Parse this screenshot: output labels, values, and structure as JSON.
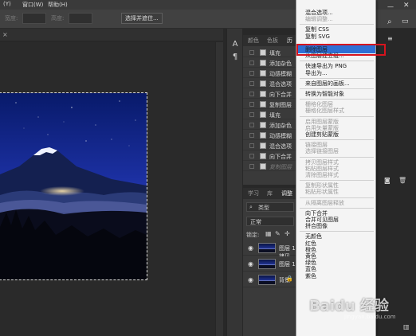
{
  "menubar": {
    "items": [
      "(Y)",
      "窗口(W)",
      "帮助(H)"
    ],
    "icons": [
      "home-icon",
      "minimize-icon",
      "close-icon"
    ]
  },
  "options_bar": {
    "width_label": "宽度:",
    "height_label": "高度:",
    "select_subject_button": "选择并遮住..."
  },
  "tool_column": {
    "text_tool_glyph": "A",
    "paragraph_glyph": "¶"
  },
  "history_panel": {
    "tabs": [
      "颜色",
      "色板",
      "历"
    ],
    "rows": [
      {
        "label": "填充",
        "dim": false
      },
      {
        "label": "添加杂色",
        "dim": false
      },
      {
        "label": "动感模糊",
        "dim": false
      },
      {
        "label": "混合选项",
        "dim": false
      },
      {
        "label": "向下合并",
        "dim": false
      },
      {
        "label": "复制图层",
        "dim": false
      },
      {
        "label": "填充",
        "dim": false
      },
      {
        "label": "添加杂色",
        "dim": false
      },
      {
        "label": "动感模糊",
        "dim": false
      },
      {
        "label": "混合选项",
        "dim": false
      },
      {
        "label": "向下合并",
        "dim": false
      },
      {
        "label": "复制图层",
        "dim": true
      }
    ]
  },
  "layers_panel": {
    "tabs": [
      "学习",
      "库",
      "调整"
    ],
    "filter_label": "类型",
    "blend_mode": "正常",
    "lock_label": "锁定:",
    "layers": [
      {
        "name": "图层 1 拷贝",
        "locked": false
      },
      {
        "name": "图层 1",
        "locked": false
      },
      {
        "name": "背景",
        "locked": true
      }
    ]
  },
  "context_menu": {
    "items": [
      {
        "label": "混合选项...",
        "enabled": true
      },
      {
        "label": "编辑调整...",
        "enabled": false
      },
      {
        "sep": true
      },
      {
        "label": "复制 CSS",
        "enabled": true
      },
      {
        "label": "复制 SVG",
        "enabled": true
      },
      {
        "label": "复制图层...",
        "enabled": true,
        "highlighted": true
      },
      {
        "label": "删除图层",
        "enabled": true
      },
      {
        "label": "从图层建立组...",
        "enabled": true
      },
      {
        "sep": true
      },
      {
        "label": "快速导出为 PNG",
        "enabled": true
      },
      {
        "label": "导出为...",
        "enabled": true
      },
      {
        "sep": true
      },
      {
        "label": "来自图层的画板...",
        "enabled": true
      },
      {
        "sep": true
      },
      {
        "label": "转换为智能对象",
        "enabled": true
      },
      {
        "sep": true
      },
      {
        "label": "栅格化图层",
        "enabled": false
      },
      {
        "label": "栅格化图层样式",
        "enabled": false
      },
      {
        "sep": true
      },
      {
        "label": "启用图层蒙版",
        "enabled": false
      },
      {
        "label": "启用矢量蒙版",
        "enabled": false
      },
      {
        "label": "创建剪贴蒙版",
        "enabled": true
      },
      {
        "sep": true
      },
      {
        "label": "链接图层",
        "enabled": false
      },
      {
        "label": "选择链接图层",
        "enabled": false
      },
      {
        "sep": true
      },
      {
        "label": "拷贝图层样式",
        "enabled": false
      },
      {
        "label": "粘贴图层样式",
        "enabled": false
      },
      {
        "label": "清除图层样式",
        "enabled": false
      },
      {
        "sep": true
      },
      {
        "label": "复制形状属性",
        "enabled": false
      },
      {
        "label": "粘贴形状属性",
        "enabled": false
      },
      {
        "sep": true
      },
      {
        "label": "从隔离图层释放",
        "enabled": false
      },
      {
        "sep": true
      },
      {
        "label": "向下合并",
        "enabled": true
      },
      {
        "label": "合并可见图层",
        "enabled": true
      },
      {
        "label": "拼合图像",
        "enabled": true
      },
      {
        "sep": true
      },
      {
        "label": "无颜色",
        "enabled": true
      },
      {
        "label": "红色",
        "enabled": true
      },
      {
        "label": "橙色",
        "enabled": true
      },
      {
        "label": "黄色",
        "enabled": true
      },
      {
        "label": "绿色",
        "enabled": true
      },
      {
        "label": "蓝色",
        "enabled": true
      },
      {
        "label": "紫色",
        "enabled": true
      }
    ]
  },
  "watermark": {
    "text": "Baidu 经验",
    "sub": "jingyan.baidu.com"
  },
  "colors": {
    "highlight": "#2f6fd4",
    "annotation_frame": "#d6141e",
    "panel_bg": "#3a3a3a"
  }
}
